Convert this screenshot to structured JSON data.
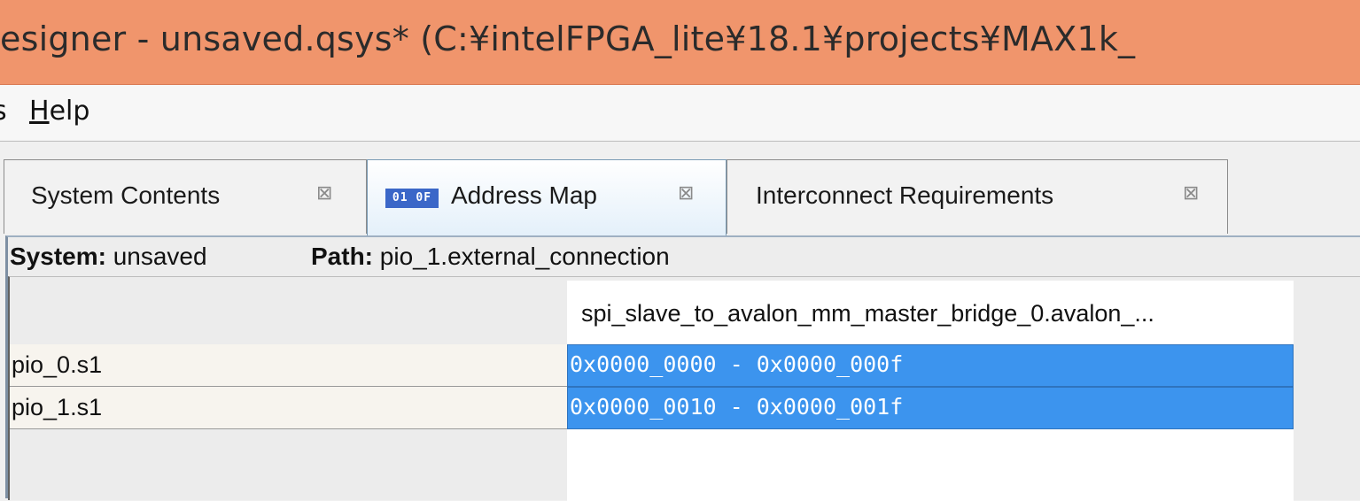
{
  "window": {
    "title": "esigner - unsaved.qsys* (C:¥intelFPGA_lite¥18.1¥projects¥MAX1k_"
  },
  "menubar": {
    "items": [
      {
        "label": "s",
        "mnemonic": ""
      },
      {
        "label": "elp",
        "mnemonic": "H"
      }
    ]
  },
  "tabs": [
    {
      "label": "System Contents",
      "active": false
    },
    {
      "label": "Address Map",
      "active": true,
      "icon": "address-map-icon",
      "icon_text": "01 0F"
    },
    {
      "label": "Interconnect Requirements",
      "active": false
    }
  ],
  "close_glyph": "⊠",
  "info": {
    "system_label": "System:",
    "system_value": "unsaved",
    "path_label": "Path:",
    "path_value": "pio_1.external_connection"
  },
  "address_map": {
    "columns": [
      "spi_slave_to_avalon_mm_master_bridge_0.avalon_..."
    ],
    "rows": [
      {
        "slave": "pio_0.s1",
        "range": "0x0000_0000 - 0x0000_000f"
      },
      {
        "slave": "pio_1.s1",
        "range": "0x0000_0010 - 0x0000_001f"
      }
    ]
  },
  "colors": {
    "title_bar": "#f0956c",
    "selection": "#3c94ee"
  }
}
